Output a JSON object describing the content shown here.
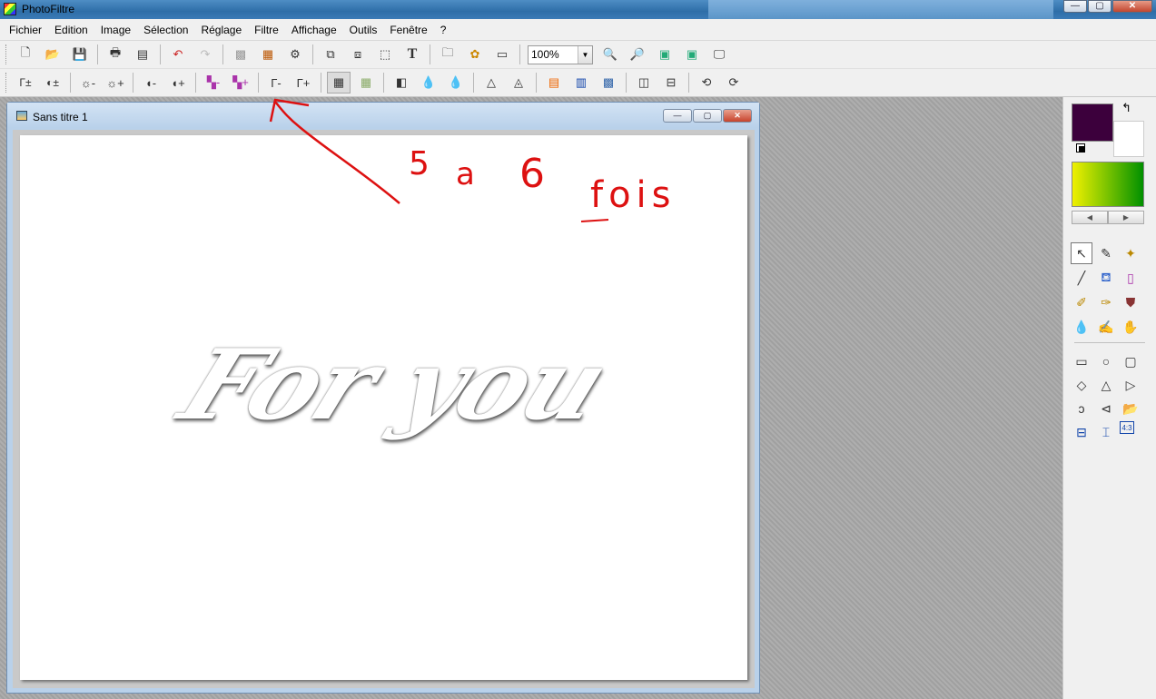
{
  "window": {
    "title": "PhotoFiltre",
    "minimize": "—",
    "maximize": "▢",
    "close": "✕"
  },
  "menu": [
    "Fichier",
    "Edition",
    "Image",
    "Sélection",
    "Réglage",
    "Filtre",
    "Affichage",
    "Outils",
    "Fenêtre",
    "?"
  ],
  "toolbar": {
    "zoom_value": "100%"
  },
  "document": {
    "title": "Sans titre 1",
    "minimize": "—",
    "maximize": "▢",
    "close": "✕"
  },
  "canvas": {
    "art_text": "For you"
  },
  "annotation": {
    "text_1": "5",
    "text_2": "a",
    "text_3": "6",
    "text_4": "fois"
  },
  "colors": {
    "foreground": "#3c003c",
    "background": "#ffffff",
    "gradient_start": "#f0f000",
    "gradient_end": "#009000",
    "annotation": "#dd1111"
  }
}
